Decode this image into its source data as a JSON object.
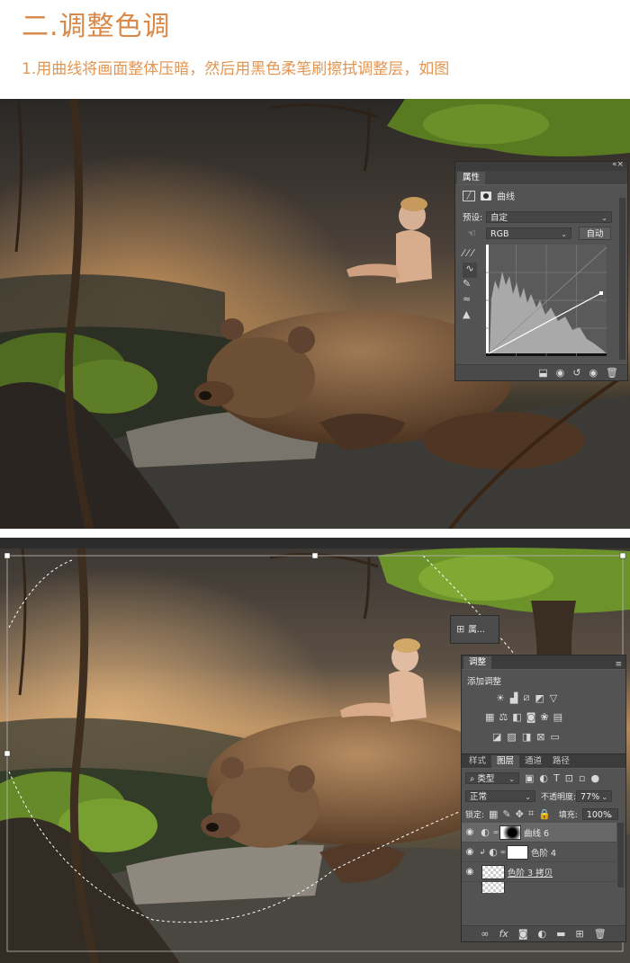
{
  "header": {
    "title": "二.调整色调",
    "description": "1.用曲线将画面整体压暗，然后用黑色柔笔刷擦拭调整层，如图"
  },
  "colors": {
    "accent": "#d9894a",
    "panel_bg": "#535353",
    "panel_dark": "#424242"
  },
  "properties_panel": {
    "tab": "属性",
    "adjustment_name": "曲线",
    "preset_label": "预设:",
    "preset_value": "自定",
    "channel_value": "RGB",
    "auto_button": "自动",
    "tool_icons": [
      "eyedropper-black-icon",
      "eyedropper-gray-icon",
      "eyedropper-white-icon",
      "curve-point-icon",
      "pencil-icon",
      "smooth-icon",
      "clipping-warning-icon"
    ],
    "bottom_icons": [
      "clip-to-layer-icon",
      "view-previous-icon",
      "reset-icon",
      "visibility-icon",
      "delete-icon"
    ]
  },
  "collapsed_panel": {
    "label": "属..."
  },
  "adjustments_panel": {
    "tab": "调整",
    "heading": "添加调整",
    "icon_rows": [
      [
        "brightness-contrast-icon",
        "levels-icon",
        "curves-icon",
        "exposure-icon",
        "vibrance-icon"
      ],
      [
        "hue-saturation-icon",
        "color-balance-icon",
        "black-white-icon",
        "photo-filter-icon",
        "channel-mixer-icon",
        "color-lookup-icon"
      ],
      [
        "invert-icon",
        "posterize-icon",
        "threshold-icon",
        "selective-color-icon",
        "gradient-map-icon"
      ]
    ]
  },
  "layers_panel": {
    "tabs": [
      "样式",
      "图层",
      "通道",
      "路径"
    ],
    "active_tab": "图层",
    "filter_kind": "类型",
    "blend_mode": "正常",
    "opacity_label": "不透明度:",
    "opacity_value": "77%",
    "lock_label": "锁定:",
    "fill_label": "填充:",
    "fill_value": "100%",
    "layers": [
      {
        "name": "曲线 6",
        "selected": true
      },
      {
        "name": "色阶 4",
        "selected": false
      },
      {
        "name": "色阶 3 拷贝",
        "selected": false
      }
    ],
    "bottom_icons": [
      "link-icon",
      "fx-icon",
      "mask-icon",
      "adjustment-icon",
      "group-icon",
      "new-layer-icon",
      "trash-icon"
    ],
    "fx_label": "fx"
  }
}
